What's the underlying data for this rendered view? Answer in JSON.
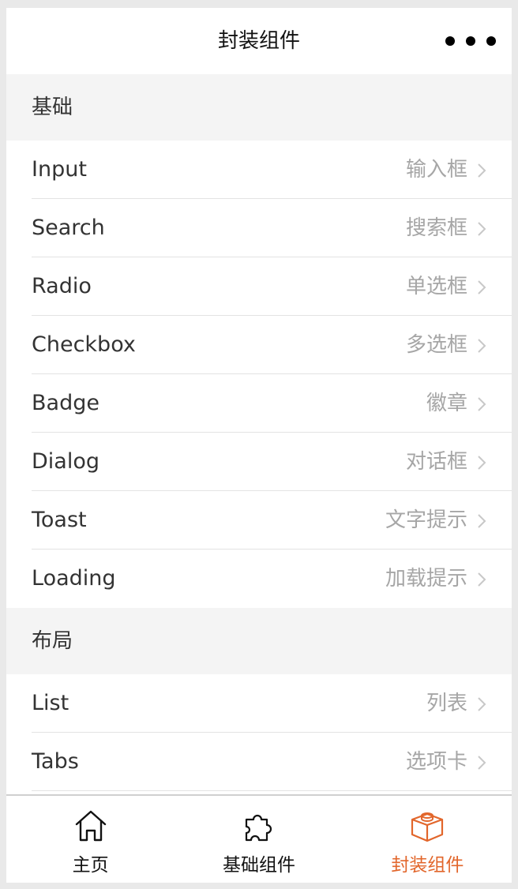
{
  "navbar": {
    "title": "封装组件",
    "more_icon": "more-dots-icon"
  },
  "sections": [
    {
      "title": "基础",
      "items": [
        {
          "en": "Input",
          "zh": "输入框"
        },
        {
          "en": "Search",
          "zh": "搜索框"
        },
        {
          "en": "Radio",
          "zh": "单选框"
        },
        {
          "en": "Checkbox",
          "zh": "多选框"
        },
        {
          "en": "Badge",
          "zh": "徽章"
        },
        {
          "en": "Dialog",
          "zh": "对话框"
        },
        {
          "en": "Toast",
          "zh": "文字提示"
        },
        {
          "en": "Loading",
          "zh": "加载提示"
        }
      ]
    },
    {
      "title": "布局",
      "items": [
        {
          "en": "List",
          "zh": "列表"
        },
        {
          "en": "Tabs",
          "zh": "选项卡"
        }
      ]
    }
  ],
  "tabbar": {
    "tabs": [
      {
        "label": "主页",
        "icon": "home-icon",
        "active": false
      },
      {
        "label": "基础组件",
        "icon": "puzzle-icon",
        "active": false
      },
      {
        "label": "封装组件",
        "icon": "block-icon",
        "active": true
      }
    ]
  },
  "colors": {
    "accent": "#e2662b",
    "section_bg": "#f4f4f4",
    "secondary_text": "#a6a6a6"
  }
}
